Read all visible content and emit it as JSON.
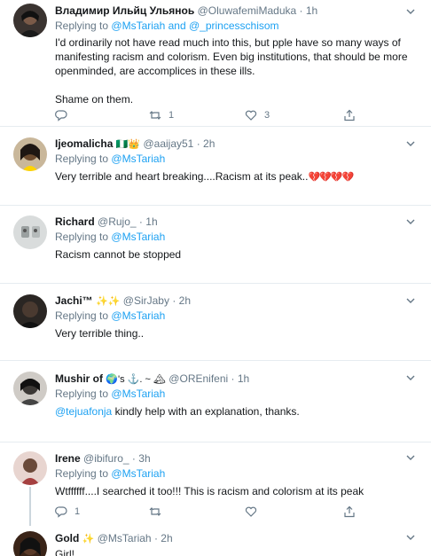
{
  "tweets": [
    {
      "name": "Владимир Ильйц Ульяноь",
      "handle": "@OluwafemiMaduka",
      "time": "1h",
      "reply_label": "Replying to",
      "reply_to": "@MsTariah",
      "reply_and": "and",
      "reply_to2": "@_princesschisom",
      "text": "I'd ordinarily not have read much into this, but pple have so many ways of manifesting racism and colorism. Even big institutions, that should be more openminded, are accomplices in these ills.\n\nShame on them.",
      "retweets": "1",
      "likes": "3",
      "avatar_color": "#3a3330"
    },
    {
      "name": "Ijeomalicha",
      "name_flags": "🇳🇬👑",
      "handle": "@aaijay51",
      "time": "2h",
      "reply_label": "Replying to",
      "reply_to": "@MsTariah",
      "text": "Very terrible and heart breaking....Racism at its peak..",
      "text_emoji": "💔💔💔💔",
      "avatar_color": "#6b4a2e"
    },
    {
      "name": "Richard",
      "handle": "@Rujo_",
      "time": "1h",
      "reply_label": "Replying to",
      "reply_to": "@MsTariah",
      "text": "Racism cannot be stopped",
      "avatar_color": "#d9dcdc"
    },
    {
      "name": "Jachi™",
      "name_flags": "✨✨",
      "handle": "@SirJaby",
      "time": "2h",
      "reply_label": "Replying to",
      "reply_to": "@MsTariah",
      "text": "Very terrible thing..",
      "avatar_color": "#2a2623"
    },
    {
      "name": "Mushir of",
      "name_flags": "🌍's ⚓. ~ 🏔",
      "handle": "@OREnifeni",
      "time": "1h",
      "reply_label": "Replying to",
      "reply_to": "@MsTariah",
      "text_mention": "@tejuafonja",
      "text": " kindly help with an explanation, thanks.",
      "avatar_color": "#3b3835"
    },
    {
      "name": "Irene",
      "handle": "@ibifuro_",
      "time": "3h",
      "reply_label": "Replying to",
      "reply_to": "@MsTariah",
      "text": "Wtffffff....I searched it too!!! This is racism and colorism at its peak",
      "replies": "1",
      "avatar_color": "#a54040"
    },
    {
      "name": "Gold",
      "name_flags": "✨",
      "handle": "@MsTariah",
      "time": "2h",
      "text": "Girl!",
      "avatar_color": "#3a2418"
    }
  ],
  "separator": "·",
  "icons": {
    "reply": "reply-icon",
    "retweet": "retweet-icon",
    "like": "heart-icon",
    "share": "share-icon",
    "caret": "chevron-down-icon"
  },
  "colors": {
    "link": "#1da1f2",
    "muted": "#657786",
    "divider": "#e6ecf0"
  }
}
